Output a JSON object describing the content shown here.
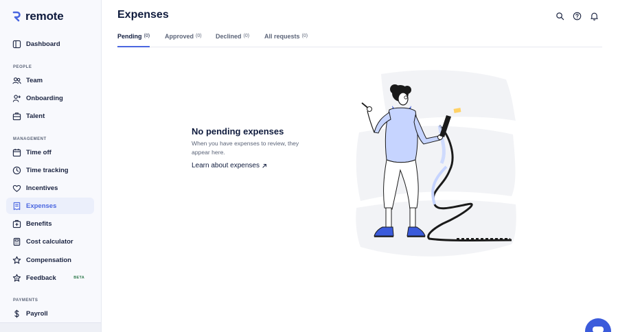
{
  "app": {
    "logo_text": "remote"
  },
  "sidebar": {
    "items": [
      {
        "label": "Dashboard"
      },
      {
        "label": "Team"
      },
      {
        "label": "Onboarding"
      },
      {
        "label": "Talent"
      },
      {
        "label": "Time off"
      },
      {
        "label": "Time tracking"
      },
      {
        "label": "Incentives"
      },
      {
        "label": "Expenses",
        "active": true
      },
      {
        "label": "Benefits"
      },
      {
        "label": "Cost calculator"
      },
      {
        "label": "Compensation"
      },
      {
        "label": "Feedback",
        "badge": "BETA"
      },
      {
        "label": "Payroll"
      }
    ],
    "sections": {
      "people": "PEOPLE",
      "management": "MANAGEMENT",
      "payments": "PAYMENTS"
    }
  },
  "header": {
    "title": "Expenses",
    "icons": [
      "search-icon",
      "help-icon",
      "bell-icon"
    ]
  },
  "tabs": [
    {
      "label": "Pending",
      "count": "(0)",
      "active": true
    },
    {
      "label": "Approved",
      "count": "(0)"
    },
    {
      "label": "Declined",
      "count": "(0)"
    },
    {
      "label": "All requests",
      "count": "(0)"
    }
  ],
  "empty_state": {
    "title": "No pending expenses",
    "description": "When you have expenses to review, they appear here.",
    "link_label": "Learn about expenses"
  },
  "colors": {
    "accent": "#4a66e0",
    "text": "#0f1b3d",
    "muted": "#5b6478",
    "active_bg": "#ebeffb",
    "chat_button": "#3b5bdb"
  }
}
